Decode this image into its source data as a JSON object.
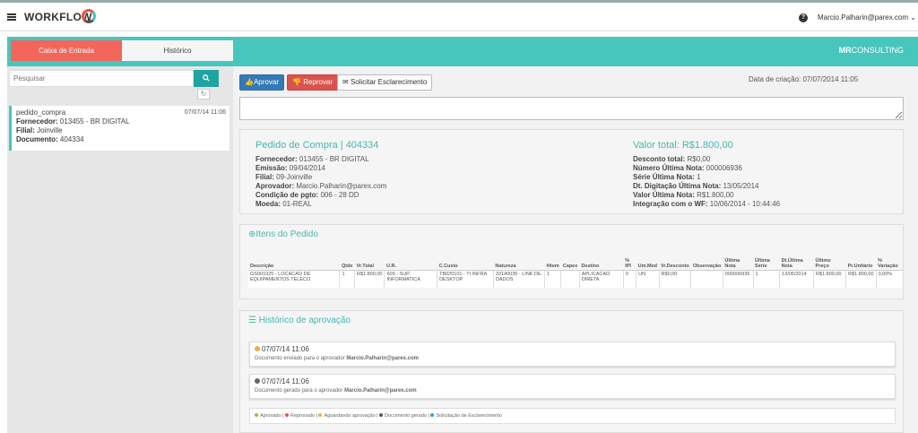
{
  "brand": {
    "name": "WORKFLOW"
  },
  "header": {
    "help_icon": "?",
    "user": "Marcio.Palharin@parex.com ⌄"
  },
  "sidebar": {
    "tabs": [
      {
        "label": "Caixa de Entrada"
      },
      {
        "label": "Histórico"
      }
    ],
    "search": {
      "placeholder": "Pesquisar"
    },
    "items": [
      {
        "title": "pedido_compra",
        "date": "07/07/14 11:06",
        "supplier_label": "Fornecedor:",
        "supplier": "013455 - BR DIGITAL",
        "branch_label": "Filial:",
        "branch": "Joinville",
        "document_label": "Documento:",
        "document": "404334"
      }
    ]
  },
  "main": {
    "logo": {
      "bold": "MR",
      "thin": "CONSULTING"
    },
    "buttons": {
      "approve": "Aprovar",
      "reject": "Reprovar",
      "clarify": "Solicitar Esclarecimento"
    },
    "creation_date": "Data de criação: 07/07/2014 11:05",
    "order": {
      "title": "Pedido de Compra | 404334",
      "fields": [
        {
          "label": "Fornecedor:",
          "value": "013455 - BR DIGITAL"
        },
        {
          "label": "Emissão:",
          "value": "09/04/2014"
        },
        {
          "label": "Filial:",
          "value": "09-Joinville"
        },
        {
          "label": "Aprovador:",
          "value": "Marcio.Palharin@parex.com"
        },
        {
          "label": "Condição de pgto:",
          "value": "006 - 28 DD"
        },
        {
          "label": "Moeda:",
          "value": "01-REAL"
        }
      ],
      "total_title": "Valor total: R$1.800,00",
      "total_fields": [
        {
          "label": "Desconto total:",
          "value": "R$0,00"
        },
        {
          "label": "Número Última Nota:",
          "value": "000006936"
        },
        {
          "label": "Série Última Nota:",
          "value": "1"
        },
        {
          "label": "Dt. Digitação Última Nota:",
          "value": "13/05/2014"
        },
        {
          "label": "Valor Última Nota:",
          "value": "R$1.800,00"
        },
        {
          "label": "Integração com o WF:",
          "value": "10/06/2014 - 10:44:46"
        }
      ]
    },
    "items": {
      "title": "Itens do Pedido",
      "columns": [
        "Descrição",
        "Qtde",
        "Vr.Total",
        "U.R.",
        "C.Custo",
        "Natureza",
        "#Item",
        "Capex",
        "Destino",
        "% IPI",
        "Um.Med",
        "Vr.Desconto",
        "Observação",
        "Última Nota",
        "Última Série",
        "Dt.Última Nota",
        "Último Preço",
        "Pr.Unitário",
        "% Variação"
      ],
      "rows": [
        [
          "GS001025 - LOCACAO DE EQUIPAMENTOS TELECO",
          "1",
          "R$1.800,00",
          "609 - SUP. INFORMATICA",
          "TB020101 - TI INFRA DESKTOP",
          "33140035 - LINK DE DADOS",
          "1",
          "",
          "APLICACAO DIRETA",
          "0",
          "UN",
          "R$0,00",
          "",
          "000006936",
          "1",
          "13/05/2014",
          "R$1.800,00",
          "R$1.800,00",
          "0,00%"
        ]
      ]
    },
    "history": {
      "title": "Histórico de aprovação",
      "entries": [
        {
          "when": "07/07/14 11:06",
          "desc": "Documento enviado para o aprovador",
          "who": "Marcio.Palharin@parex.com",
          "color": "#f0ad4e"
        },
        {
          "when": "07/07/14 11:06",
          "desc": "Documento gerado para o aprovador",
          "who": "Marcio.Palharin@parex.com",
          "color": "#666666"
        }
      ],
      "legend": [
        {
          "label": "Aprovado",
          "color": "#8bc34a"
        },
        {
          "label": "Reprovado",
          "color": "#e8553e"
        },
        {
          "label": "Aguardando aprovação",
          "color": "#f0ad4e"
        },
        {
          "label": "Documento gerado",
          "color": "#555555"
        },
        {
          "label": "Solicitação de Esclarecimento",
          "color": "#3a9bdc"
        }
      ]
    }
  }
}
